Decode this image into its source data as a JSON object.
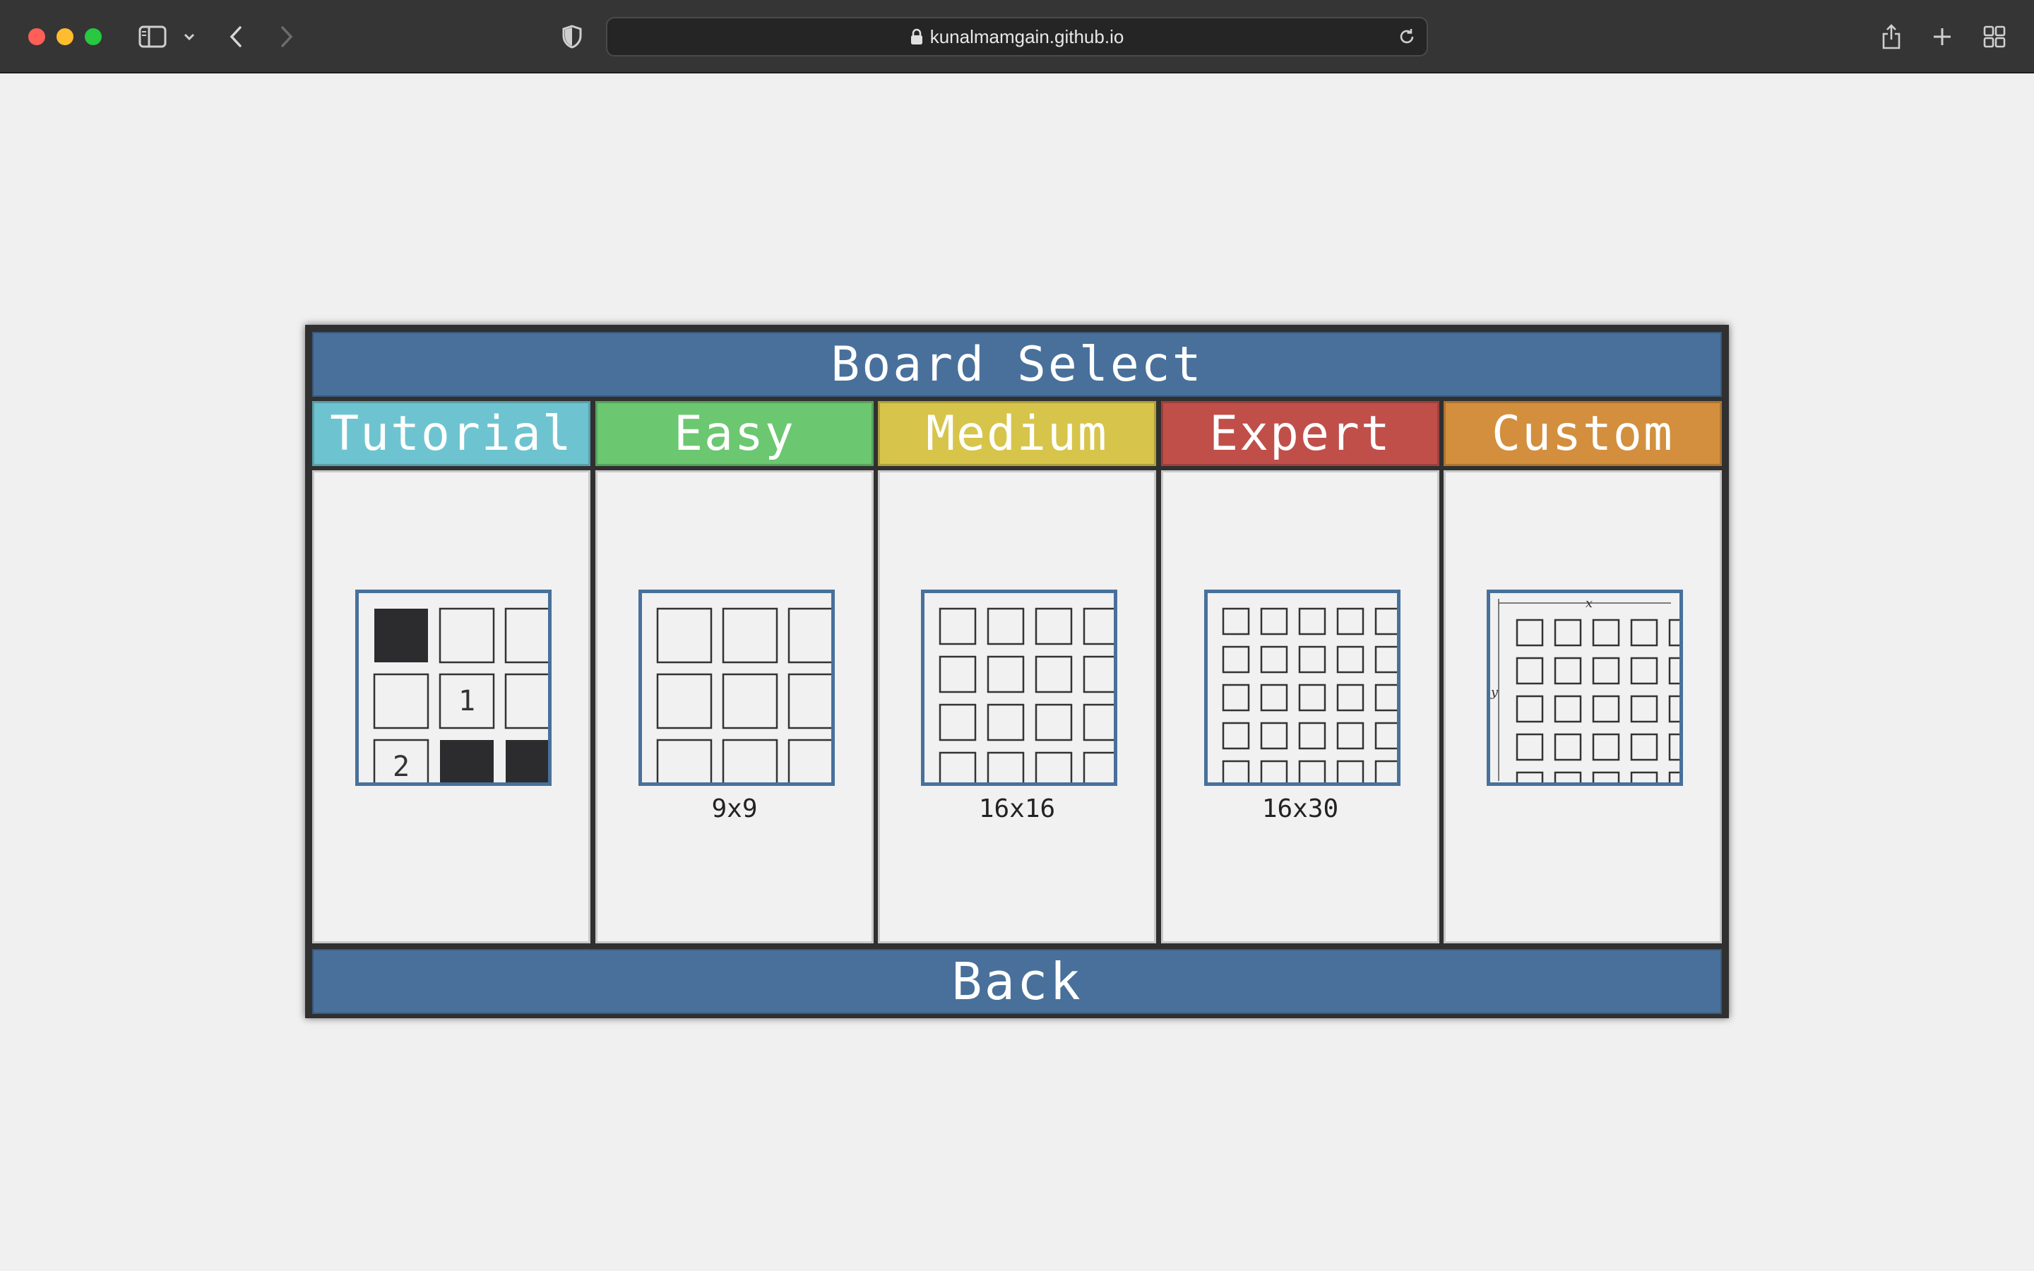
{
  "browser": {
    "url": "kunalmamgain.github.io",
    "icons": [
      "sidebar-icon",
      "chevron-down-icon",
      "back-icon",
      "forward-icon",
      "privacy-shield-icon",
      "lock-icon",
      "reload-icon",
      "share-icon",
      "new-tab-icon",
      "tab-overview-icon"
    ]
  },
  "board": {
    "title": "Board Select",
    "colors": {
      "header": "#48709b",
      "tutorial": "#6dc4d0",
      "easy": "#6cc771",
      "medium": "#d7c44a",
      "expert": "#c04f4a",
      "custom": "#d38f3d"
    },
    "modes": [
      {
        "label": "Tutorial",
        "size": ""
      },
      {
        "label": "Easy",
        "size": "9x9"
      },
      {
        "label": "Medium",
        "size": "16x16"
      },
      {
        "label": "Expert",
        "size": "16x30"
      },
      {
        "label": "Custom",
        "size": ""
      }
    ],
    "tutorial_cells": [
      "1",
      "2"
    ],
    "custom_axes": {
      "x": "x",
      "y": "y"
    },
    "back_label": "Back"
  }
}
